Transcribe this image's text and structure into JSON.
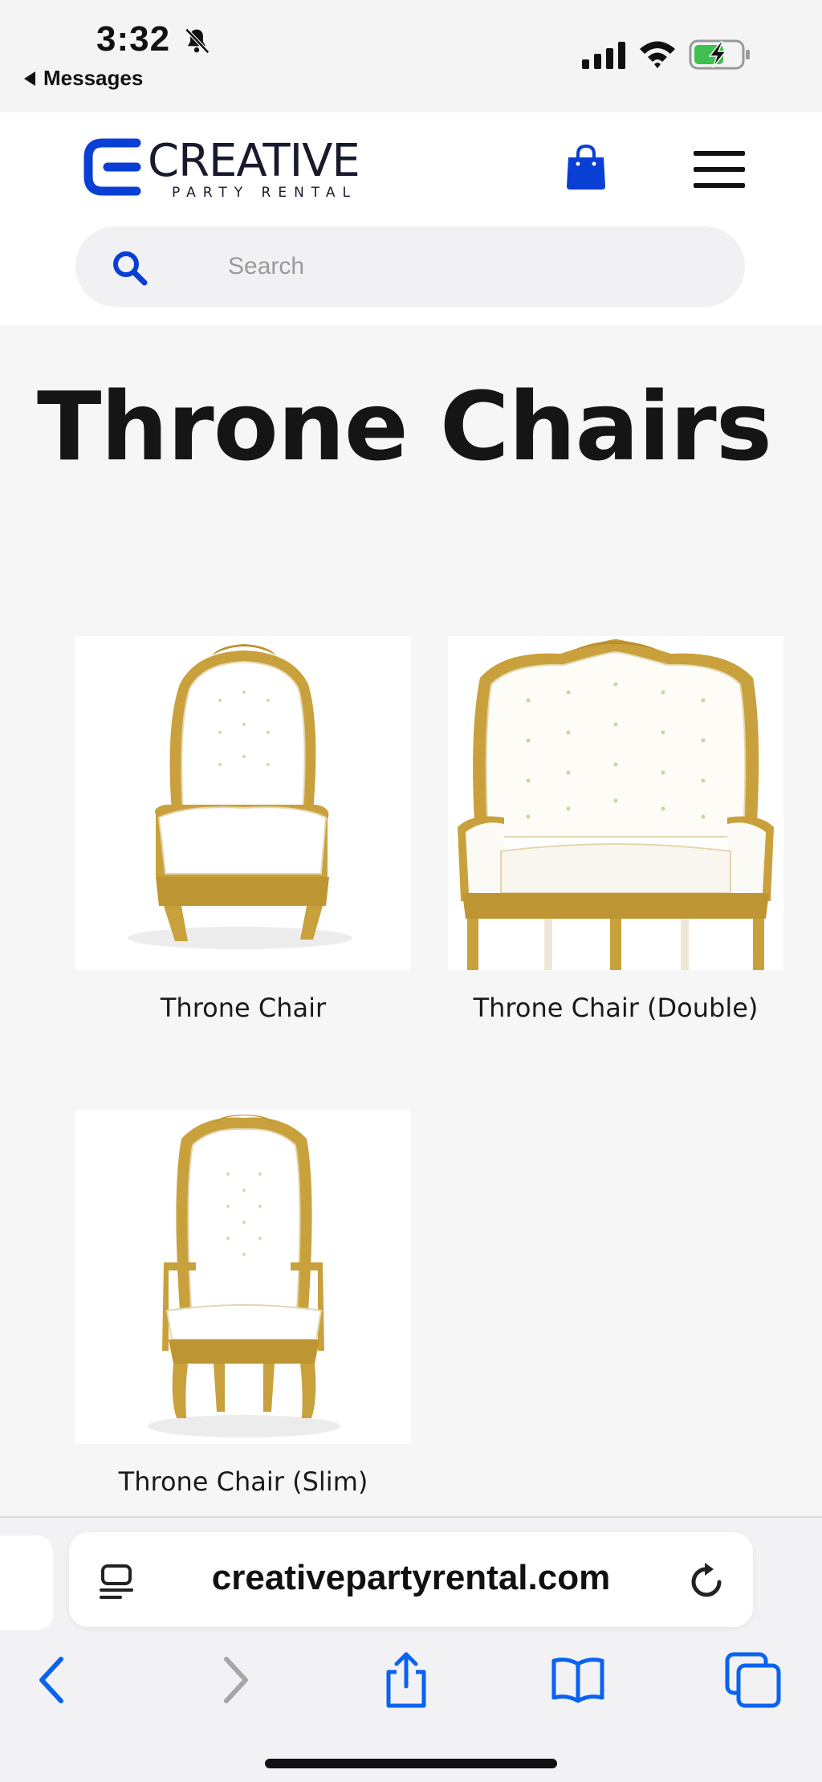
{
  "status_bar": {
    "time": "3:32",
    "back_label": "Messages"
  },
  "header": {
    "logo_word": "CREATIVE",
    "logo_sub": "PARTY RENTAL",
    "brand_color": "#0a3fd6"
  },
  "search": {
    "placeholder": "Search"
  },
  "page": {
    "title": "Throne Chairs"
  },
  "products": [
    {
      "name": "Throne Chair"
    },
    {
      "name": "Throne Chair (Double)"
    },
    {
      "name": "Throne Chair (Slim)"
    }
  ],
  "browser": {
    "url": "creativepartyrental.com"
  }
}
